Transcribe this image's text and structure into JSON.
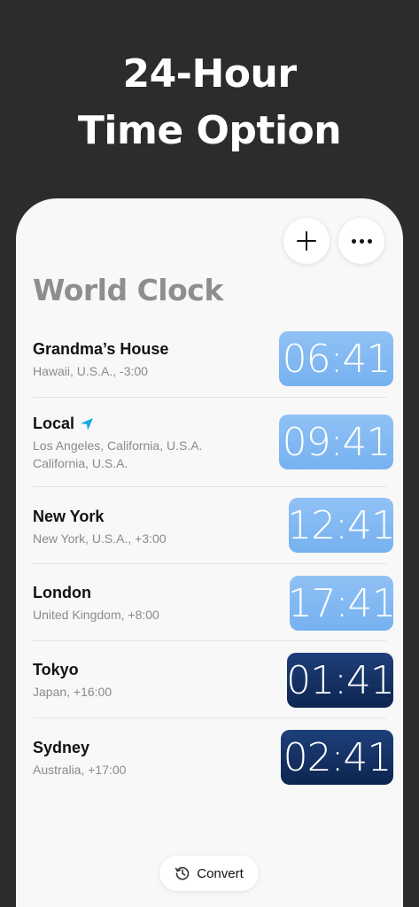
{
  "headline": {
    "line1": "24-Hour",
    "line2": "Time Option"
  },
  "page_title": "World Clock",
  "toolbar": {
    "add_icon": "plus-icon",
    "more_icon": "ellipsis-icon"
  },
  "clocks": [
    {
      "city": "Grandma’s House",
      "sub1": "Hawaii, U.S.A., -3:00",
      "sub2": "",
      "time": "06:41",
      "theme": "day"
    },
    {
      "city": "Local",
      "sub1": "Los Angeles, California, U.S.A.",
      "sub2": "California, U.S.A.",
      "time": "09:41",
      "theme": "day",
      "icon": "location-arrow-icon"
    },
    {
      "city": "New York",
      "sub1": "New York, U.S.A., +3:00",
      "sub2": "",
      "time": "12:41",
      "theme": "day"
    },
    {
      "city": "London",
      "sub1": "United Kingdom, +8:00",
      "sub2": "",
      "time": "17:41",
      "theme": "day"
    },
    {
      "city": "Tokyo",
      "sub1": "Japan, +16:00",
      "sub2": "",
      "time": "01:41",
      "theme": "night"
    },
    {
      "city": "Sydney",
      "sub1": "Australia, +17:00",
      "sub2": "",
      "time": "02:41",
      "theme": "night"
    }
  ],
  "convert": {
    "label": "Convert",
    "icon": "history-icon"
  },
  "colors": {
    "day_clock": "#80b8f2",
    "night_clock": "#13305f",
    "background": "#2c2c2c",
    "accent_location": "#1aa7e8"
  }
}
